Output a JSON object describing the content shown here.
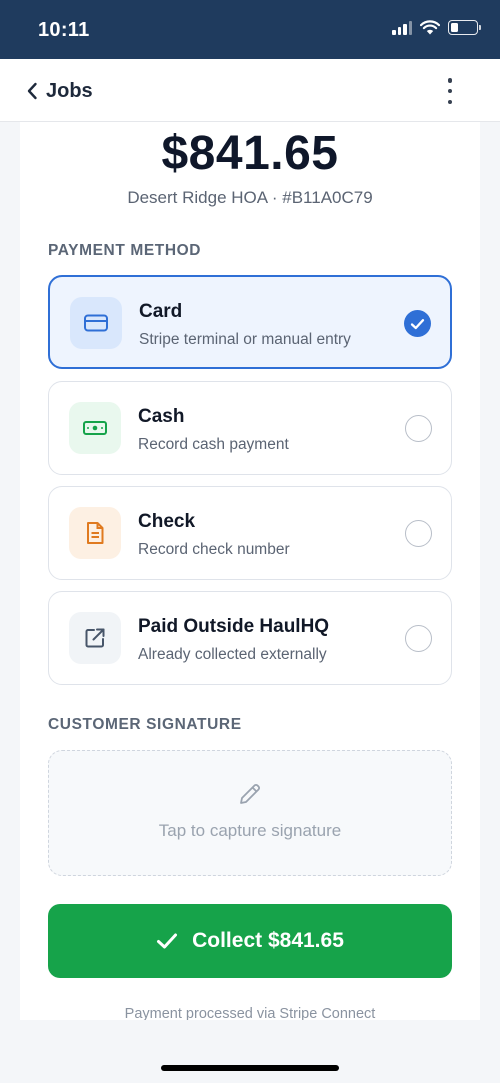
{
  "status_bar": {
    "time": "10:11"
  },
  "nav": {
    "back_label": "Jobs"
  },
  "payment": {
    "amount": "$841.65",
    "subtitle": "Desert Ridge HOA · #B11A0C79"
  },
  "sections": {
    "payment_method": "PAYMENT METHOD",
    "customer_signature": "CUSTOMER SIGNATURE"
  },
  "methods": [
    {
      "title": "Card",
      "subtitle": "Stripe terminal or manual entry",
      "icon": "credit-card-icon",
      "selected": true,
      "accent": "#2f6fd6"
    },
    {
      "title": "Cash",
      "subtitle": "Record cash payment",
      "icon": "cash-icon",
      "selected": false,
      "accent": "#16a34a"
    },
    {
      "title": "Check",
      "subtitle": "Record check number",
      "icon": "document-icon",
      "selected": false,
      "accent": "#e07a1f"
    },
    {
      "title": "Paid Outside HaulHQ",
      "subtitle": "Already collected externally",
      "icon": "external-link-icon",
      "selected": false,
      "accent": "#475569"
    }
  ],
  "signature": {
    "placeholder": "Tap to capture signature",
    "icon": "pencil-icon"
  },
  "collect_button": {
    "label": "Collect $841.65",
    "color": "#16a34a"
  },
  "footnote": "Payment processed via Stripe Connect"
}
